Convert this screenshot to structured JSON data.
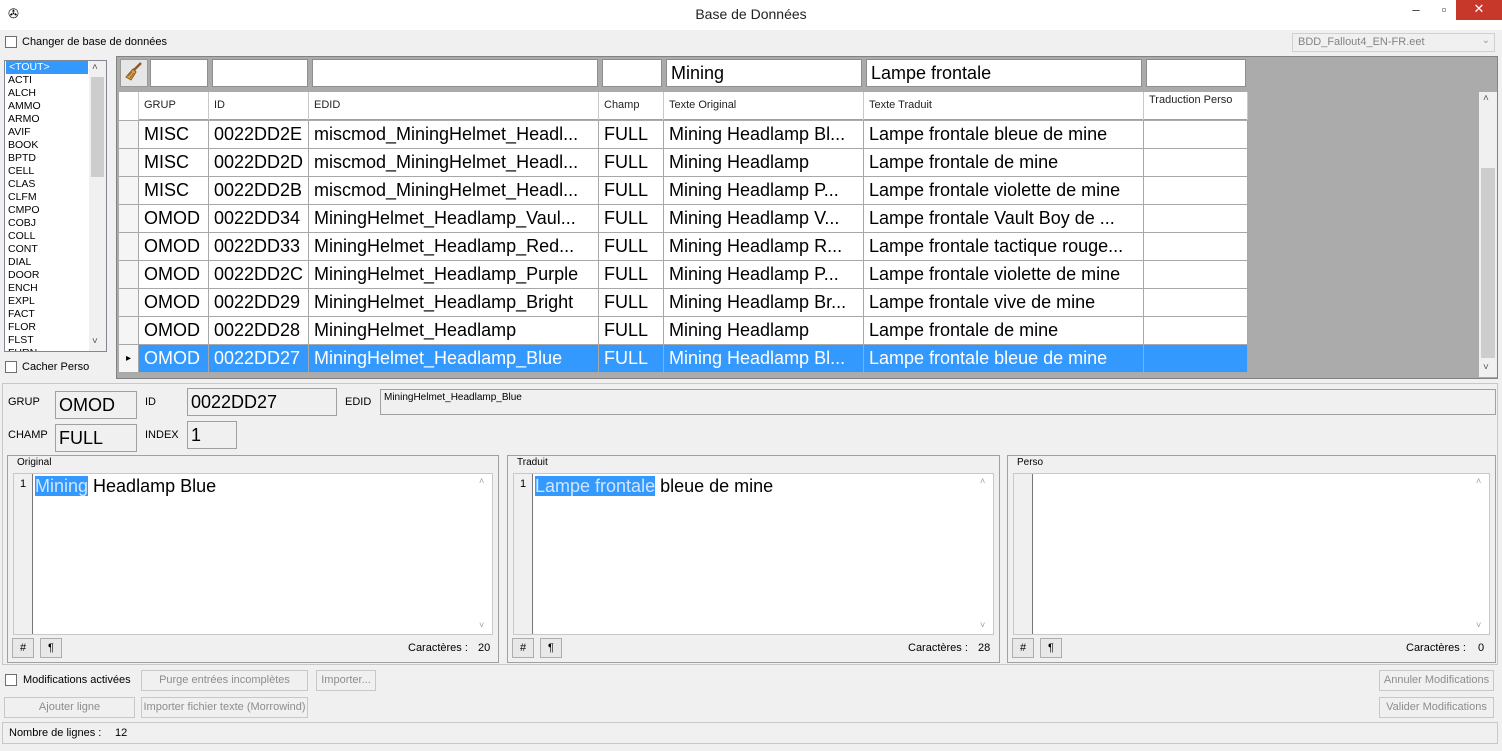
{
  "window": {
    "title": "Base de Données"
  },
  "top": {
    "change_db_label": "Changer de base de données",
    "db_file": "BDD_Fallout4_EN-FR.eet"
  },
  "types": [
    "<TOUT>",
    "ACTI",
    "ALCH",
    "AMMO",
    "ARMO",
    "AVIF",
    "BOOK",
    "BPTD",
    "CELL",
    "CLAS",
    "CLFM",
    "CMPO",
    "COBJ",
    "COLL",
    "CONT",
    "DIAL",
    "DOOR",
    "ENCH",
    "EXPL",
    "FACT",
    "FLOR",
    "FLST",
    "FURN"
  ],
  "hide_perso_label": "Cacher Perso",
  "filters": {
    "grup": "",
    "id": "",
    "edid": "",
    "champ": "",
    "original": "Mining",
    "traduit": "Lampe frontale",
    "perso": ""
  },
  "columns": [
    "GRUP",
    "ID",
    "EDID",
    "Champ",
    "Texte Original",
    "Texte Traduit",
    "Traduction Perso"
  ],
  "rows": [
    [
      "MISC",
      "0022DD2E",
      "miscmod_MiningHelmet_Headl...",
      "FULL",
      "Mining Headlamp Bl...",
      "Lampe frontale bleue de mine",
      ""
    ],
    [
      "MISC",
      "0022DD2D",
      "miscmod_MiningHelmet_Headl...",
      "FULL",
      "Mining Headlamp",
      "Lampe frontale de mine",
      ""
    ],
    [
      "MISC",
      "0022DD2B",
      "miscmod_MiningHelmet_Headl...",
      "FULL",
      "Mining Headlamp P...",
      "Lampe frontale violette de mine",
      ""
    ],
    [
      "OMOD",
      "0022DD34",
      "MiningHelmet_Headlamp_Vaul...",
      "FULL",
      "Mining Headlamp V...",
      "Lampe frontale Vault Boy de ...",
      ""
    ],
    [
      "OMOD",
      "0022DD33",
      "MiningHelmet_Headlamp_Red...",
      "FULL",
      "Mining Headlamp R...",
      "Lampe frontale tactique rouge...",
      ""
    ],
    [
      "OMOD",
      "0022DD2C",
      "MiningHelmet_Headlamp_Purple",
      "FULL",
      "Mining Headlamp P...",
      "Lampe frontale violette de mine",
      ""
    ],
    [
      "OMOD",
      "0022DD29",
      "MiningHelmet_Headlamp_Bright",
      "FULL",
      "Mining Headlamp Br...",
      "Lampe frontale vive de mine",
      ""
    ],
    [
      "OMOD",
      "0022DD28",
      "MiningHelmet_Headlamp",
      "FULL",
      "Mining Headlamp",
      "Lampe frontale de mine",
      ""
    ],
    [
      "OMOD",
      "0022DD27",
      "MiningHelmet_Headlamp_Blue",
      "FULL",
      "Mining Headlamp Bl...",
      "Lampe frontale bleue de mine",
      ""
    ]
  ],
  "detail": {
    "grup_label": "GRUP",
    "grup": "OMOD",
    "id_label": "ID",
    "id": "0022DD27",
    "edid_label": "EDID",
    "edid": "MiningHelmet_Headlamp_Blue",
    "champ_label": "CHAMP",
    "champ": "FULL",
    "index_label": "INDEX",
    "index": "1"
  },
  "panels": {
    "original": {
      "title": "Original",
      "line_no": "1",
      "highlight": "Mining",
      "rest": " Headlamp Blue",
      "chars_label": "Caractères :",
      "chars": "20"
    },
    "traduit": {
      "title": "Traduit",
      "line_no": "1",
      "highlight": "Lampe frontale",
      "rest": " bleue de mine",
      "chars_label": "Caractères :",
      "chars": "28"
    },
    "perso": {
      "title": "Perso",
      "chars_label": "Caractères :",
      "chars": "0"
    },
    "hash": "#",
    "pilcrow": "¶"
  },
  "bottom": {
    "mods_enabled": "Modifications activées",
    "purge": "Purge entrées incomplètes",
    "import": "Importer...",
    "add_line": "Ajouter ligne",
    "import_text": "Importer fichier texte (Morrowind)",
    "cancel_mods": "Annuler Modifications",
    "validate_mods": "Valider Modifications"
  },
  "status": {
    "rows_label": "Nombre de lignes :",
    "rows_count": "12"
  }
}
